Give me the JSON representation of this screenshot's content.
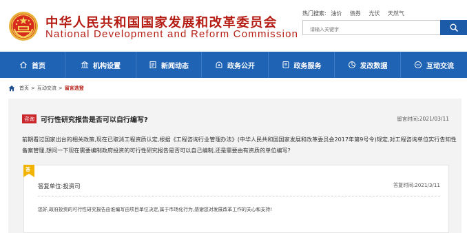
{
  "site": {
    "name_cn": "中华人民共和国国家发展和改革委员会",
    "name_en": "National Development and Reform Commission"
  },
  "hot_search": {
    "label": "热门搜索:",
    "terms": [
      "油价",
      "债券",
      "光伏",
      "天然气"
    ]
  },
  "search": {
    "placeholder": "请输入关键字"
  },
  "nav": {
    "items": [
      {
        "label": "首页",
        "icon": "home-icon"
      },
      {
        "label": "机构设置",
        "icon": "building-icon"
      },
      {
        "label": "新闻动态",
        "icon": "news-icon"
      },
      {
        "label": "政务公开",
        "icon": "open-affairs-icon"
      },
      {
        "label": "政务服务",
        "icon": "service-icon"
      },
      {
        "label": "发改数据",
        "icon": "data-chart-icon"
      },
      {
        "label": "互动交流",
        "icon": "chat-icon"
      }
    ]
  },
  "breadcrumb": {
    "items": [
      "首页",
      "互动交流"
    ],
    "current": "留言选登",
    "separator": ">"
  },
  "question": {
    "badge": "咨询",
    "title": "可行性研究报告是否可以自行编写?",
    "time": "留言时间:2021/03/11",
    "body": "前期看过国家出台的相关政策,现在已取消工程资质认定,根据《工程咨询行业管理办法》(中华人民共和国国家发展和改革委员会2017年第9号令)规定,对工程咨询单位实行告知性备案管理,想问一下现在需要编制政府投资的可行性研究报告是否可以自己编制,还是需要由有资质的单位编写?"
  },
  "answer": {
    "flag": "答",
    "unit": "答复单位:投资司",
    "time": "答复时间:2021/3/11",
    "body": "您好,政府投资的可行性研究报告由谁编写由项目单位决定,属于市场化行为,感谢您对发展改革工作的关心和支持!"
  },
  "colors": {
    "brand_red": "#b51d14",
    "nav_blue": "#1f63b4",
    "search_button": "#1c5ba7",
    "badge_red": "#c9262c"
  }
}
